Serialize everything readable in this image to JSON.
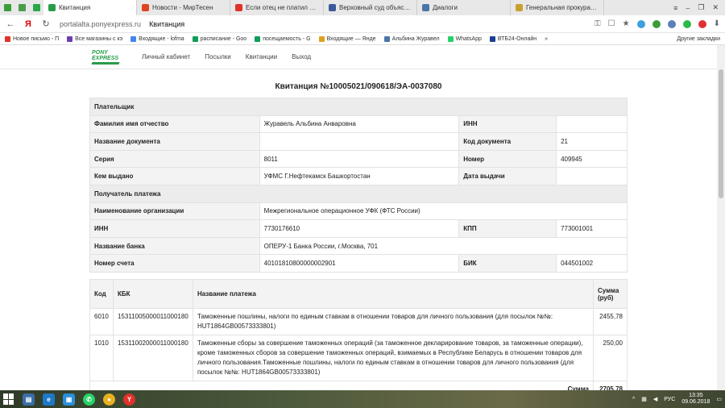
{
  "browser": {
    "tabs": [
      {
        "label": "Квитанция",
        "active": true,
        "color": "#2a9d4a"
      },
      {
        "label": "Новости - МирТесен",
        "active": false,
        "color": "#e0431f"
      },
      {
        "label": "Если отец не платил алим",
        "active": false,
        "color": "#e0322a"
      },
      {
        "label": "Верховный суд объяснил",
        "active": false,
        "color": "#3b5998"
      },
      {
        "label": "Диалоги",
        "active": false,
        "color": "#4a76a8"
      },
      {
        "label": "Генеральная прокуратур",
        "active": false,
        "color": "#c8a030"
      }
    ],
    "url_domain": "portalalta.ponyexpress.ru",
    "url_title": "Квитанция",
    "browser_letter": "Я",
    "bookmarks": [
      {
        "label": "Новое письмо - П",
        "color": "#e0322a"
      },
      {
        "label": "Все магазины с кэ",
        "color": "#6a3fb0"
      },
      {
        "label": "Входящие - lofma",
        "color": "#4285f4"
      },
      {
        "label": "расписание - Goo",
        "color": "#0f9d58"
      },
      {
        "label": "посещаемость - G",
        "color": "#0f9d58"
      },
      {
        "label": "Входящие — Янде",
        "color": "#e0a020"
      },
      {
        "label": "Альбина Журавел",
        "color": "#4a76a8"
      },
      {
        "label": "WhatsApp",
        "color": "#25d366"
      },
      {
        "label": "ВТБ24-Онлайн",
        "color": "#1a3f8f"
      }
    ],
    "other_bookmarks": "Другие закладки"
  },
  "site": {
    "logo_line1": "PONY",
    "logo_line2": "EXPRESS",
    "nav": [
      "Личный кабинет",
      "Посылки",
      "Квитанции",
      "Выход"
    ]
  },
  "receipt": {
    "title": "Квитанция №10005021/090618/ЭА-0037080",
    "payer_section": "Плательщик",
    "fio_label": "Фамилия имя отчество",
    "fio_value": "Журавель Альбина Анваровна",
    "inn_label": "ИНН",
    "inn_value": "",
    "doc_name_label": "Название документа",
    "doc_name_value": "",
    "doc_code_label": "Код документа",
    "doc_code_value": "21",
    "series_label": "Серия",
    "series_value": "8011",
    "number_label": "Номер",
    "number_value": "409945",
    "issued_by_label": "Кем выдано",
    "issued_by_value": "УФМС Г.Нефтекамск Башкортостан",
    "issue_date_label": "Дата выдачи",
    "issue_date_value": "",
    "recipient_section": "Получатель платежа",
    "org_label": "Наименование организации",
    "org_value": "Межрегиональное операционное УФК (ФТС России)",
    "r_inn_label": "ИНН",
    "r_inn_value": "7730176610",
    "kpp_label": "КПП",
    "kpp_value": "773001001",
    "bank_label": "Название банка",
    "bank_value": "ОПЕРУ-1 Банка России, г.Москва, 701",
    "account_label": "Номер счета",
    "account_value": "40101810800000002901",
    "bik_label": "БИК",
    "bik_value": "044501002"
  },
  "payments": {
    "headers": {
      "code": "Код",
      "kbk": "КБК",
      "name": "Название платежа",
      "sum": "Сумма (руб)"
    },
    "rows": [
      {
        "code": "6010",
        "kbk": "15311005000011000180",
        "name": "Таможенные пошлины, налоги по единым ставкам в отношении товаров для личного пользования (для посылок №№: HUT1864GB00573333801)",
        "sum": "2455,78"
      },
      {
        "code": "1010",
        "kbk": "15311002000011000180",
        "name": "Таможенные сборы за совершение таможенных операций (за таможенное декларирование товаров, за таможенные операции), кроме таможенных сборов за совершение таможенных операций, взимаемых в Республике Беларусь в отношении товаров для личного пользования.Таможенные пошлины, налоги по единым ставкам в отношении товаров для личного пользования (для посылок №№: HUT1864GB00573333801)",
        "sum": "250,00"
      }
    ],
    "total_label": "Сумма",
    "total_value": "2705,78"
  },
  "taskbar": {
    "lang": "РУС",
    "time": "13:35",
    "date": "09.06.2018"
  }
}
